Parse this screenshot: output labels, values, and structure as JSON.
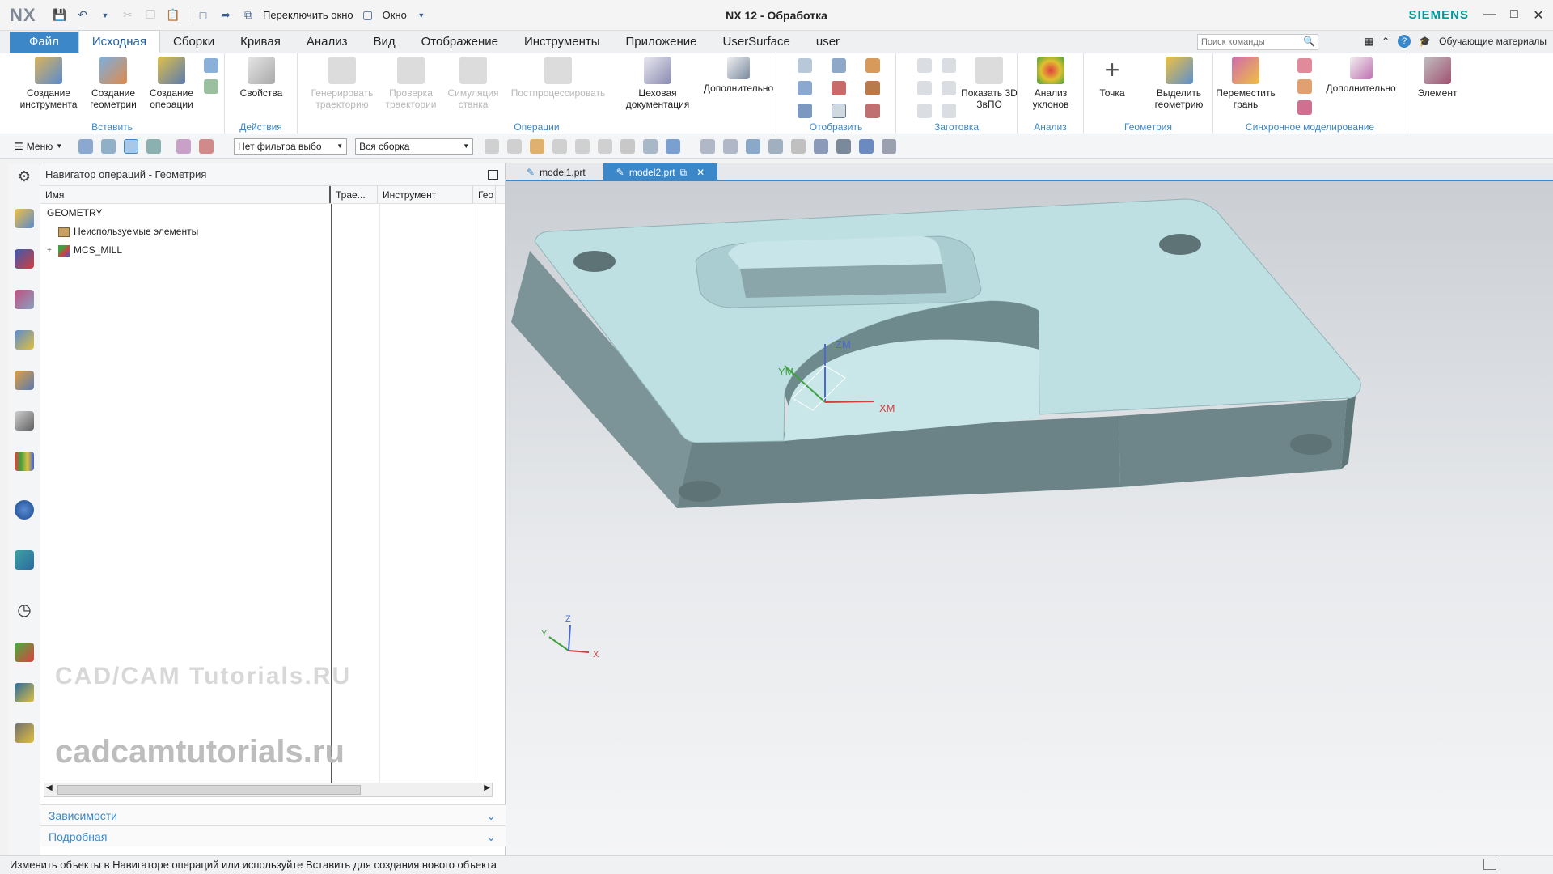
{
  "titlebar": {
    "logo": "NX",
    "switch_window": "Переключить окно",
    "window": "Окно",
    "title": "NX 12 - Обработка",
    "brand": "SIEMENS"
  },
  "tabs": [
    {
      "label": "Файл"
    },
    {
      "label": "Исходная"
    },
    {
      "label": "Сборки"
    },
    {
      "label": "Кривая"
    },
    {
      "label": "Анализ"
    },
    {
      "label": "Вид"
    },
    {
      "label": "Отображение"
    },
    {
      "label": "Инструменты"
    },
    {
      "label": "Приложение"
    },
    {
      "label": "UserSurface"
    },
    {
      "label": "user"
    }
  ],
  "search": {
    "placeholder": "Поиск команды"
  },
  "learning": "Обучающие материалы",
  "ribbon": {
    "create_tool": "Создание инструмента",
    "create_geometry": "Создание геометрии",
    "create_operation": "Создание операции",
    "insert_group": "Вставить",
    "properties": "Свойства",
    "actions_group": "Действия",
    "generate_path": "Генерировать траекторию",
    "verify_path": "Проверка траектории",
    "simulate_machine": "Симуляция станка",
    "postprocess": "Постпроцессировать",
    "shop_docs": "Цеховая документация",
    "more1": "Дополнительно",
    "operations_group": "Операции",
    "display_group": "Отобразить",
    "show_3d_ipw": "Показать 3D ЗвПО",
    "blank_group": "Заготовка",
    "draft_analysis": "Анализ уклонов",
    "analysis_group": "Анализ",
    "point": "Точка",
    "extract_geometry": "Выделить геометрию",
    "geometry_group": "Геометрия",
    "move_face": "Переместить грань",
    "more2": "Дополнительно",
    "sync_group": "Синхронное моделирование",
    "element": "Элемент"
  },
  "toolbar": {
    "menu": "Меню",
    "filter": "Нет фильтра выбо",
    "assembly": "Вся сборка"
  },
  "navigator": {
    "title": "Навигатор операций - Геометрия",
    "columns": [
      "Имя",
      "Трае...",
      "Инструмент",
      "Гео"
    ],
    "rows": [
      {
        "name": "GEOMETRY"
      },
      {
        "name": "Неиспользуемые элементы"
      },
      {
        "name": "MCS_MILL"
      }
    ],
    "dependencies": "Зависимости",
    "details": "Подробная",
    "watermark_logo": "CAD/CAM Tutorials.RU",
    "watermark": "cadcamtutorials.ru"
  },
  "doc_tabs": [
    {
      "label": "model1.prt"
    },
    {
      "label": "model2.prt"
    }
  ],
  "viewport": {
    "zm": "ZM",
    "ym": "YM",
    "xm": "XM",
    "x": "X",
    "y": "Y",
    "z": "Z"
  },
  "status": "Изменить объекты в Навигаторе операций или используйте Вставить для создания нового объекта",
  "colors": {
    "accent": "#3c87c8",
    "brand": "#009999",
    "part_top": "#bfe0e3",
    "part_side": "#6f8a8d"
  }
}
